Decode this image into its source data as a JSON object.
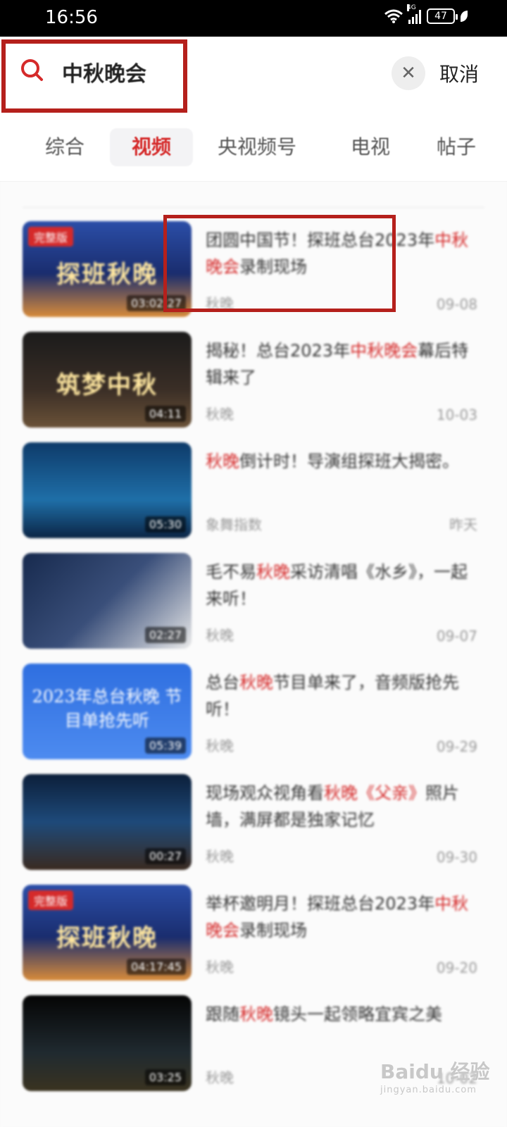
{
  "status_bar": {
    "time": "16:56",
    "network": "4G",
    "battery": "47"
  },
  "search": {
    "query": "中秋晚会",
    "cancel_label": "取消"
  },
  "tabs": [
    {
      "label": "综合"
    },
    {
      "label": "视频"
    },
    {
      "label": "央视频号"
    },
    {
      "label": "电视"
    },
    {
      "label": "帖子"
    }
  ],
  "active_tab": "视频",
  "videos": [
    {
      "title_pre": "团圆中国节！探班总台2023年",
      "title_hl": "中秋晚会",
      "title_post": "录制现场",
      "source": "秋晚",
      "date": "09-08",
      "duration": "03:02:27",
      "thumb_label": "完整版",
      "thumb_text": "探班秋晚"
    },
    {
      "title_pre": "揭秘！总台2023年",
      "title_hl": "中秋晚会",
      "title_post": "幕后特辑来了",
      "source": "秋晚",
      "date": "10-03",
      "duration": "04:11",
      "thumb_label": "",
      "thumb_text": "筑梦中秋"
    },
    {
      "title_pre": "",
      "title_hl": "秋晚",
      "title_post": "倒计时！导演组探班大揭密。",
      "source": "象舞指数",
      "date": "昨天",
      "duration": "05:30",
      "thumb_label": "",
      "thumb_text": ""
    },
    {
      "title_pre": "毛不易",
      "title_hl": "秋晚",
      "title_post": "采访清唱《水乡》，一起来听！",
      "source": "秋晚",
      "date": "09-07",
      "duration": "02:27",
      "thumb_label": "",
      "thumb_text": ""
    },
    {
      "title_pre": "总台",
      "title_hl": "秋晚",
      "title_post": "节目单来了，音频版抢先听！",
      "source": "秋晚",
      "date": "09-29",
      "duration": "05:39",
      "thumb_label": "",
      "thumb_text": "2023年总台秋晚 节目单抢先听"
    },
    {
      "title_pre": "现场观众视角看",
      "title_hl": "秋晚《父亲》",
      "title_post": "照片墙，满屏都是独家记忆",
      "source": "秋晚",
      "date": "09-30",
      "duration": "00:27",
      "thumb_label": "",
      "thumb_text": ""
    },
    {
      "title_pre": "举杯邀明月！探班总台2023年",
      "title_hl": "中秋晚会",
      "title_post": "录制现场",
      "source": "秋晚",
      "date": "09-20",
      "duration": "04:17:45",
      "thumb_label": "完整版",
      "thumb_text": "探班秋晚"
    },
    {
      "title_pre": "跟随",
      "title_hl": "秋晚",
      "title_post": "镜头一起领略宜宾之美",
      "source": "秋晚",
      "date": "10-02",
      "duration": "03:25",
      "thumb_label": "",
      "thumb_text": ""
    }
  ],
  "watermark": {
    "brand": "Baidu 经验",
    "url": "jingyan.baidu.com"
  },
  "colors": {
    "accent": "#d52a2a",
    "annotation": "#b5201c"
  }
}
